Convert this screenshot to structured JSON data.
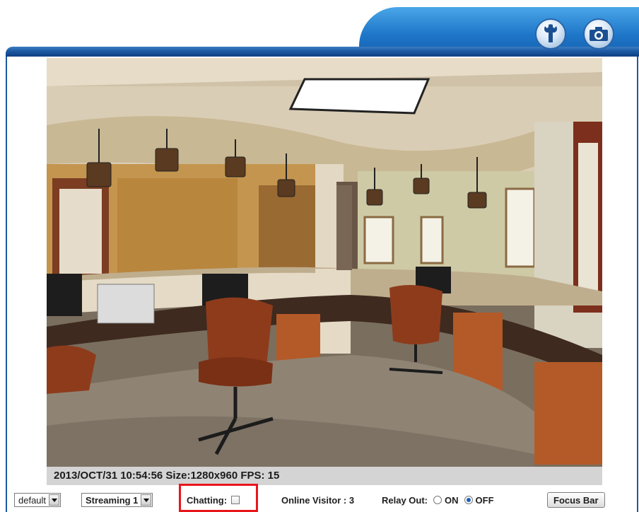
{
  "header": {
    "settings_icon": "wrench-icon",
    "snapshot_icon": "camera-icon"
  },
  "video": {
    "status_text": "2013/OCT/31 10:54:56 Size:1280x960 FPS: 15"
  },
  "controls": {
    "profile_value": "default",
    "stream_value": "Streaming 1",
    "chatting_label": "Chatting:",
    "chatting_checked": false,
    "online_visitor": "Online Visitor : 3",
    "relay_label": "Relay Out:",
    "relay_on_label": "ON",
    "relay_off_label": "OFF",
    "relay_selected": "OFF",
    "focus_button": "Focus Bar"
  },
  "colors": {
    "accent": "#1f77c9",
    "highlight_box": "#e8161b"
  }
}
